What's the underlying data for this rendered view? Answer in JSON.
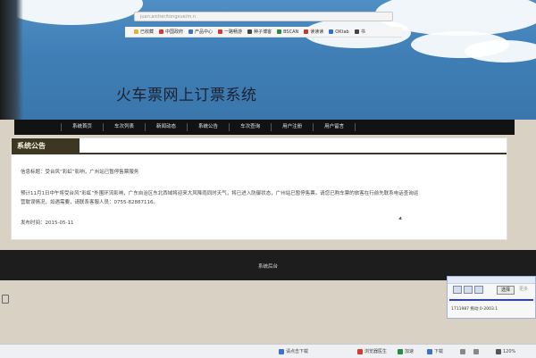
{
  "browser": {
    "address": "juan.archer/tongxue/m.n",
    "bookmarks": [
      {
        "label": "已收藏",
        "color": "#e2b23a"
      },
      {
        "label": "中国政府",
        "color": "#d33b2f"
      },
      {
        "label": "产品中心",
        "color": "#3a73c9"
      },
      {
        "label": "一路畅游",
        "color": "#d43a3a"
      },
      {
        "label": "种子博客",
        "color": "#444444"
      },
      {
        "label": "BSCAN",
        "color": "#2b8a3e"
      },
      {
        "label": "读读读",
        "color": "#c0392b"
      },
      {
        "label": "OKtab",
        "color": "#2f6fd1"
      },
      {
        "label": "书",
        "color": "#444444"
      }
    ]
  },
  "site": {
    "title": "火车票网上订票系统",
    "nav": [
      "系统首页",
      "车次列表",
      "新闻动态",
      "系统公告",
      "车次查询",
      "用户注册",
      "用户留言"
    ]
  },
  "notice": {
    "heading": "系统公告",
    "title_line": "信息标题：受台风“彩虹”影响，广州站已暂停售票服务",
    "body_line_1": "预计11月1日中午将受台风“彩虹”外围环流影响，广东自治区东北西域将迎来大风降雨同时天气，将已进入防御状态，广州站已暂停售票。请您已购车票的旅客在行前先联系电话查询运",
    "body_line_2": "营耽误情况，如遇需要，请联系客服人员：0755-82887116。",
    "date_line": "发布时间：2015-05-11"
  },
  "footer": {
    "text": "系统后台"
  },
  "widget": {
    "next_label": "选择",
    "more_label": "更多",
    "info": "1711987  拖动  0-2003.1"
  },
  "statusbar": {
    "items": [
      {
        "label": "请点击下载",
        "color": "#3a73c9"
      },
      {
        "label": "浏览器医生",
        "color": "#d33b2f"
      },
      {
        "label": "加速",
        "color": "#2b8a3e"
      },
      {
        "label": "下载",
        "color": "#3a73c9"
      },
      {
        "label": "",
        "color": "#888888"
      },
      {
        "label": "",
        "color": "#888888"
      },
      {
        "label": "120%",
        "color": "#555555"
      }
    ]
  }
}
